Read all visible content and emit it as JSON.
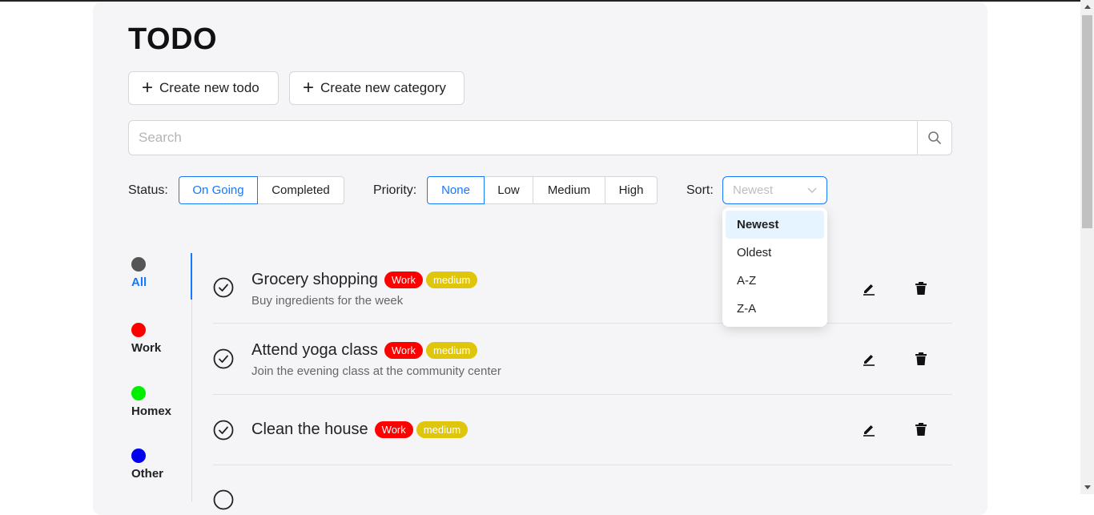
{
  "page_title": "TODO",
  "actions": {
    "create_todo": "Create new todo",
    "create_category": "Create new category"
  },
  "search": {
    "placeholder": "Search",
    "value": ""
  },
  "filters": {
    "status_label": "Status:",
    "status_options": [
      "On Going",
      "Completed"
    ],
    "status_selected": "On Going",
    "priority_label": "Priority:",
    "priority_options": [
      "None",
      "Low",
      "Medium",
      "High"
    ],
    "priority_selected": "None",
    "sort_label": "Sort:",
    "sort_placeholder": "Newest",
    "sort_options": [
      "Newest",
      "Oldest",
      "A-Z",
      "Z-A"
    ],
    "sort_highlighted": "Newest"
  },
  "categories": [
    {
      "name": "All",
      "color": "#555555",
      "active": true
    },
    {
      "name": "Work",
      "color": "#ff0000",
      "active": false
    },
    {
      "name": "Homex",
      "color": "#00ee00",
      "active": false
    },
    {
      "name": "Other",
      "color": "#0000ee",
      "active": false
    }
  ],
  "todos": [
    {
      "title": "Grocery shopping",
      "category": "Work",
      "priority": "medium",
      "description": "Buy ingredients for the week"
    },
    {
      "title": "Attend yoga class",
      "category": "Work",
      "priority": "medium",
      "description": "Join the evening class at the community center"
    },
    {
      "title": "Clean the house",
      "category": "Work",
      "priority": "medium",
      "description": ""
    }
  ],
  "colors": {
    "accent": "#1677ff",
    "category_tag": "#ff0000",
    "priority_tag": "#e0c60a"
  }
}
